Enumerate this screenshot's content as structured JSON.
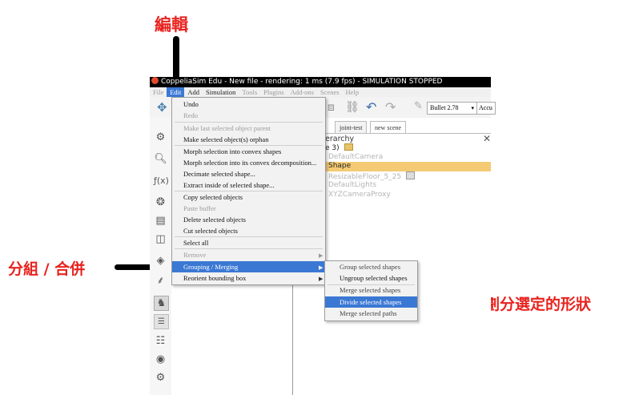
{
  "annotations": {
    "edit_label": "編輯",
    "group_label": "分組 / 合併",
    "divide_label": "劃分選定的形狀"
  },
  "window": {
    "title": "CoppeliaSim Edu - New file - rendering: 1 ms (7.9 fps) - SIMULATION STOPPED"
  },
  "menubar": [
    "File",
    "Edit",
    "Add",
    "Simulation",
    "Tools",
    "Plugins",
    "Add-ons",
    "Scenes",
    "Help"
  ],
  "toolbar": {
    "engine": "Bullet 2.78",
    "accuracy": "Accu"
  },
  "tabs": [
    "joint-test",
    "new scene"
  ],
  "hierarchy": {
    "title": "erarchy",
    "scene_line": "e 3)",
    "items": [
      "DefaultCamera",
      "Shape",
      "ResizableFloor_5_25",
      "DefaultLights",
      "XYZCameraProxy"
    ],
    "selected": "Shape"
  },
  "edit_menu": {
    "items": [
      "Undo",
      "Redo",
      "Make last selected object parent",
      "Make selected object(s) orphan",
      "Morph selection into convex shapes",
      "Morph selection into its convex decomposition...",
      "Decimate selected shape...",
      "Extract inside of selected shape...",
      "Copy selected objects",
      "Paste buffer",
      "Delete selected objects",
      "Cut selected objects",
      "Select all",
      "Remove",
      "Grouping / Merging",
      "Reorient bounding box"
    ],
    "highlighted": "Grouping / Merging"
  },
  "grouping_submenu": {
    "items": [
      "Group selected shapes",
      "Ungroup selected shapes",
      "Merge selected shapes",
      "Divide selected shapes",
      "Merge selected paths"
    ],
    "highlighted": "Divide selected shapes"
  },
  "colors": {
    "annotation": "#e8231f",
    "highlight": "#3b78d4",
    "selected_row": "#f4cb74"
  }
}
